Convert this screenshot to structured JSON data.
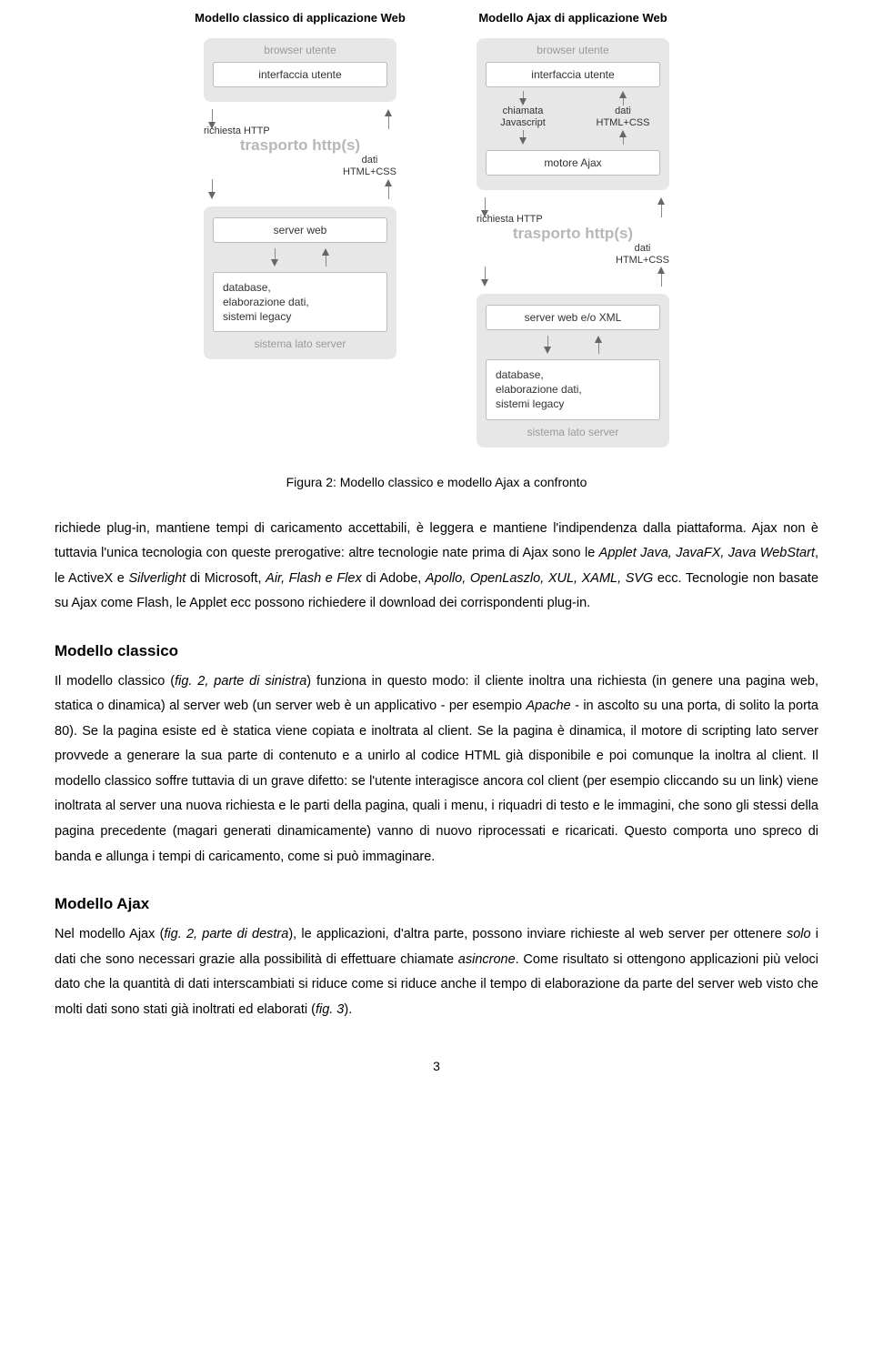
{
  "diagram": {
    "classic": {
      "title": "Modello classico di applicazione Web",
      "browser_label": "browser utente",
      "ui": "interfaccia utente",
      "req_label": "richiesta HTTP",
      "transport": "trasporto http(s)",
      "resp_label1": "dati",
      "resp_label2": "HTML+CSS",
      "server_web": "server web",
      "backend": "database,\nelaborazione dati,\nsistemi legacy",
      "server_label": "sistema lato server"
    },
    "ajax": {
      "title": "Modello Ajax di applicazione Web",
      "browser_label": "browser utente",
      "ui": "interfaccia utente",
      "js_call1": "chiamata",
      "js_call2": "Javascript",
      "inner_resp1": "dati",
      "inner_resp2": "HTML+CSS",
      "engine": "motore Ajax",
      "req_label": "richiesta HTTP",
      "transport": "trasporto http(s)",
      "resp_label1": "dati",
      "resp_label2": "HTML+CSS",
      "server_web": "server web e/o XML",
      "backend": "database,\nelaborazione dati,\nsistemi legacy",
      "server_label": "sistema lato server"
    }
  },
  "caption": "Figura 2: Modello classico e modello Ajax a confronto",
  "intro": {
    "p1a": "richiede plug-in, mantiene tempi di caricamento accettabili, è leggera e mantiene l'indipendenza dalla piattaforma. Ajax non è tuttavia l'unica tecnologia con queste prerogative: altre tecnologie nate prima di Ajax sono le ",
    "p1b": "Applet Java, JavaFX, Java WebStart",
    "p1c": ", le ActiveX e ",
    "p1d": "Silverlight",
    "p1e": " di Microsoft, ",
    "p1f": "Air, Flash e Flex",
    "p1g": " di Adobe, ",
    "p1h": "Apollo, OpenLaszlo, XUL, XAML, SVG",
    "p1i": " ecc. Tecnologie non basate su Ajax come Flash, le Applet ecc possono richiedere il download dei corrispondenti plug-in."
  },
  "classic_section": {
    "heading": "Modello classico",
    "p1a": "Il modello classico (",
    "p1b": "fig. 2, parte di sinistra",
    "p1c": ") funziona in questo modo: il cliente inoltra una richiesta (in genere una pagina web, statica o dinamica) al server web (un server web è un applicativo - per esempio ",
    "p1d": "Apache",
    "p1e": " - in ascolto su una porta, di solito la porta 80). Se la pagina esiste ed è statica viene copiata e inoltrata al client. Se la pagina è dinamica, il motore di scripting lato server provvede a generare la sua parte di contenuto e a unirlo al codice HTML già disponibile e poi comunque la inoltra al client. Il modello classico soffre tuttavia di un grave difetto: se l'utente interagisce ancora col client (per esempio cliccando su un link) viene inoltrata al server una nuova richiesta e le parti della pagina, quali i menu, i riquadri di testo e le immagini, che sono gli stessi della pagina precedente (magari generati dinamicamente) vanno di nuovo riprocessati e ricaricati. Questo comporta uno spreco di banda e allunga i tempi di caricamento, come si può immaginare."
  },
  "ajax_section": {
    "heading": "Modello Ajax",
    "p1a": "Nel modello Ajax (",
    "p1b": "fig. 2, parte di destra",
    "p1c": "), le applicazioni, d'altra parte, possono inviare richieste al web server per ottenere ",
    "p1d": "solo",
    "p1e": " i dati che sono necessari grazie alla possibilità di effettuare chiamate ",
    "p1f": "asincrone",
    "p1g": ". Come risultato si ottengono applicazioni più veloci dato che la quantità di dati interscambiati si riduce come si riduce anche il tempo di elaborazione da parte del server web visto che molti dati sono stati già inoltrati ed elaborati (",
    "p1h": "fig. 3",
    "p1i": ")."
  },
  "page_number": "3"
}
